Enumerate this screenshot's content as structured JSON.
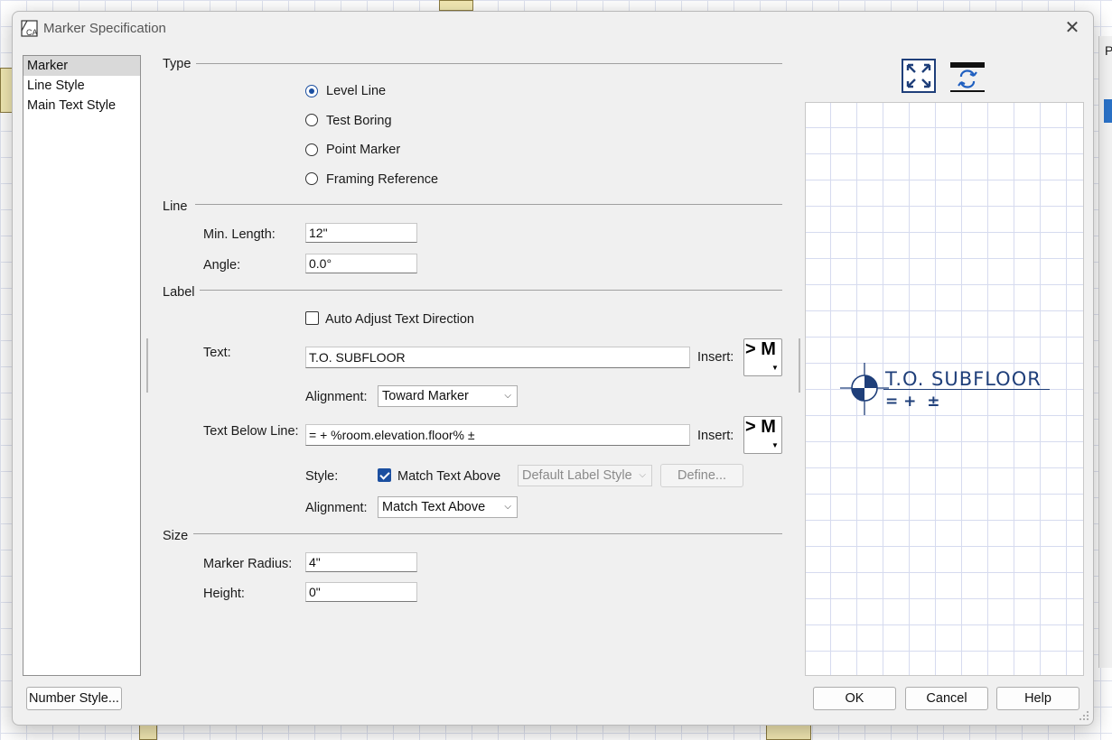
{
  "window": {
    "title": "Marker Specification",
    "close": "✕"
  },
  "background": {
    "right_edge_letter": "P"
  },
  "sidebar": {
    "items": [
      {
        "label": "Marker"
      },
      {
        "label": "Line Style"
      },
      {
        "label": "Main Text Style"
      }
    ]
  },
  "type_section": {
    "heading": "Type",
    "options": [
      "Level Line",
      "Test Boring",
      "Point Marker",
      "Framing Reference"
    ],
    "selected": "Level Line"
  },
  "line_section": {
    "heading": "Line",
    "min_length_label": "Min. Length:",
    "min_length_value": "12\"",
    "angle_label": "Angle:",
    "angle_value": "0.0°"
  },
  "label_section": {
    "heading": "Label",
    "auto_adjust_label": "Auto Adjust Text Direction",
    "auto_adjust_checked": false,
    "text_label": "Text:",
    "text_value": "T.O. SUBFLOOR",
    "insert_label": "Insert:",
    "insert_glyph": "> M",
    "alignment_label": "Alignment:",
    "alignment_value": "Toward Marker",
    "text_below_label": "Text Below Line:",
    "text_below_value": "= + %room.elevation.floor% ±",
    "insert2_label": "Insert:",
    "style_label": "Style:",
    "match_text_above_label": "Match Text Above",
    "match_text_above_checked": true,
    "style_select_value": "Default Label Style",
    "define_button": "Define...",
    "alignment2_label": "Alignment:",
    "alignment2_value": "Match Text Above"
  },
  "size_section": {
    "heading": "Size",
    "marker_radius_label": "Marker Radius:",
    "marker_radius_value": "4\"",
    "height_label": "Height:",
    "height_value": "0\""
  },
  "preview": {
    "text_above": "T.O. SUBFLOOR",
    "text_below": "= +  ±",
    "color": "#1f3f7a"
  },
  "buttons": {
    "number_style": "Number Style...",
    "ok": "OK",
    "cancel": "Cancel",
    "help": "Help"
  },
  "colors": {
    "accent": "#1b4fa0",
    "preview_ink": "#1f3f7a"
  }
}
